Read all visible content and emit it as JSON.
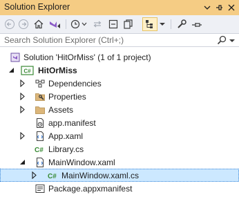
{
  "window": {
    "title": "Solution Explorer"
  },
  "search": {
    "placeholder": "Search Solution Explorer (Ctrl+;)"
  },
  "tree": {
    "solution": "Solution 'HitOrMiss' (1 of 1 project)",
    "project": "HitOrMiss",
    "project_badge": "C#",
    "dependencies": "Dependencies",
    "properties": "Properties",
    "assets": "Assets",
    "app_manifest": "app.manifest",
    "app_xaml": "App.xaml",
    "library_cs": "Library.cs",
    "library_badge": "C#",
    "mainwindow_xaml": "MainWindow.xaml",
    "mainwindow_cs": "MainWindow.xaml.cs",
    "mainwindow_cs_badge": "C#",
    "package_manifest": "Package.appxmanifest"
  },
  "colors": {
    "title_bar": "#f5cc84",
    "selection": "#cce8ff",
    "csharp_green": "#388a34",
    "folder": "#dcb67a"
  },
  "icons": [
    "back-icon",
    "forward-icon",
    "home-icon",
    "vs-icon",
    "history-icon",
    "sync-icon",
    "collapse-icon",
    "copy-icon",
    "show-all-files-icon",
    "properties-wrench-icon",
    "pin-icon",
    "search-icon"
  ]
}
